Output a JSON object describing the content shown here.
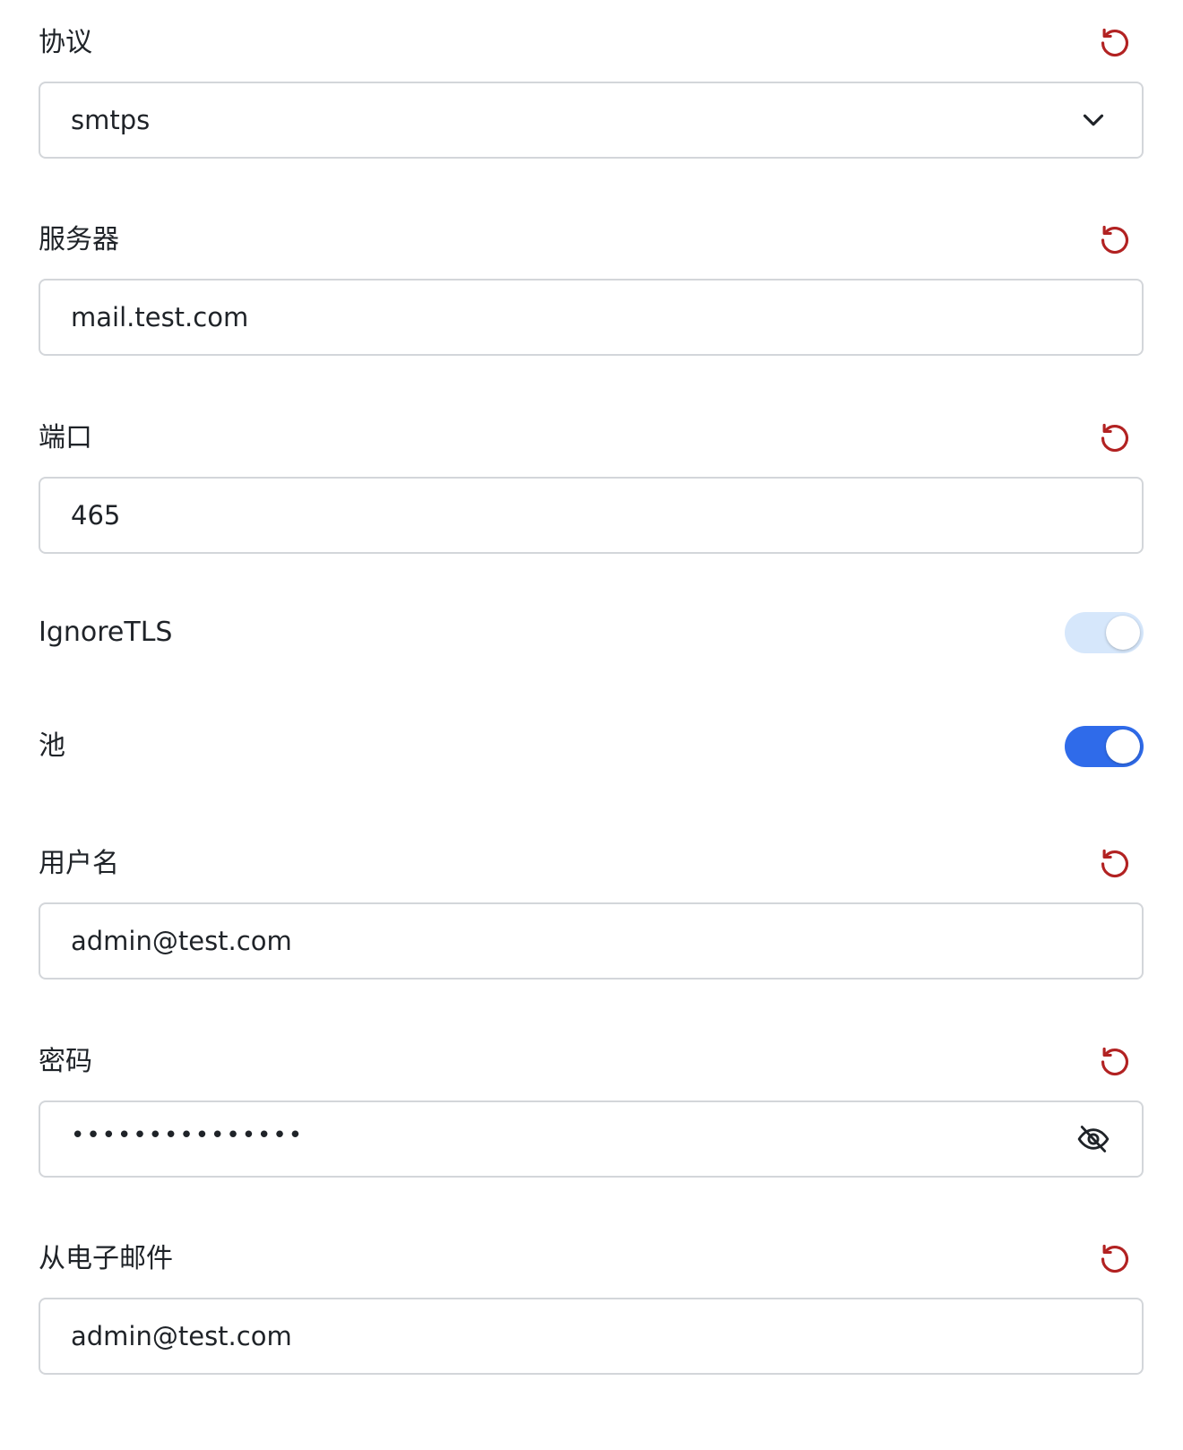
{
  "colors": {
    "reset_icon": "#b22222",
    "toggle_on": "#2f6bea",
    "toggle_off_track": "#d6e7fb",
    "input_border": "#d3d6da"
  },
  "fields": {
    "protocol": {
      "label": "协议",
      "value": "smtps",
      "trail_icon": "chevron-down-icon"
    },
    "server": {
      "label": "服务器",
      "value": "mail.test.com"
    },
    "port": {
      "label": "端口",
      "value": "465"
    },
    "ignore_tls": {
      "label": "IgnoreTLS",
      "enabled": false
    },
    "pool": {
      "label": "池",
      "enabled": true
    },
    "username": {
      "label": "用户名",
      "value": "admin@test.com"
    },
    "password": {
      "label": "密码",
      "masked_value": "•••••••••••••••",
      "trail_icon": "eye-off-icon"
    },
    "from_email": {
      "label": "从电子邮件",
      "value": "admin@test.com"
    }
  }
}
